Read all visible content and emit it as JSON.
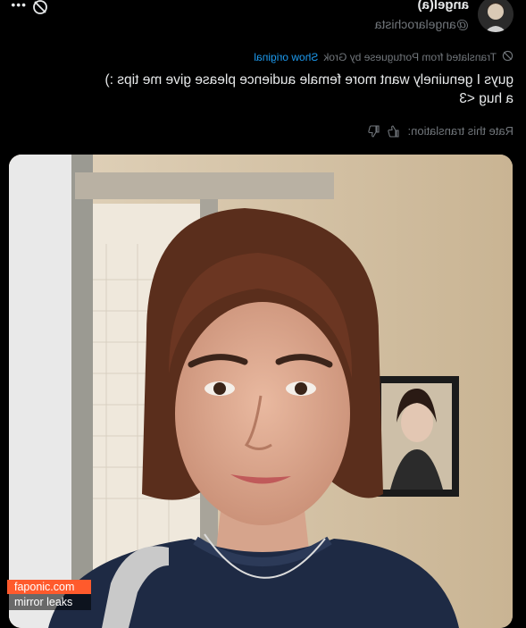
{
  "post": {
    "display_name": "angel(a)",
    "handle": "@angelarochista",
    "translated_label": "Translated from Portuguese by Grok",
    "show_original": "Show original",
    "text": "guys I genuinely want more female audience please give me tips :)\na hug <3",
    "rate_label": "Rate this translation:"
  },
  "icons": {
    "grok": "grok-icon",
    "more": "more-options-icon",
    "thumbs_up": "thumbs-up-icon",
    "thumbs_down": "thumbs-down-icon",
    "translate": "translate-icon"
  },
  "image": {
    "description_tag": "selfie-photo",
    "framed_portrait": "framed-portrait-painting"
  },
  "watermark": {
    "line1": "faponic.com",
    "line2": "mirror leaks"
  },
  "colors": {
    "background": "#000000",
    "text": "#e7e9ea",
    "secondary": "#71767b",
    "link": "#1d9bf0",
    "watermark": "#ff5a2c"
  }
}
